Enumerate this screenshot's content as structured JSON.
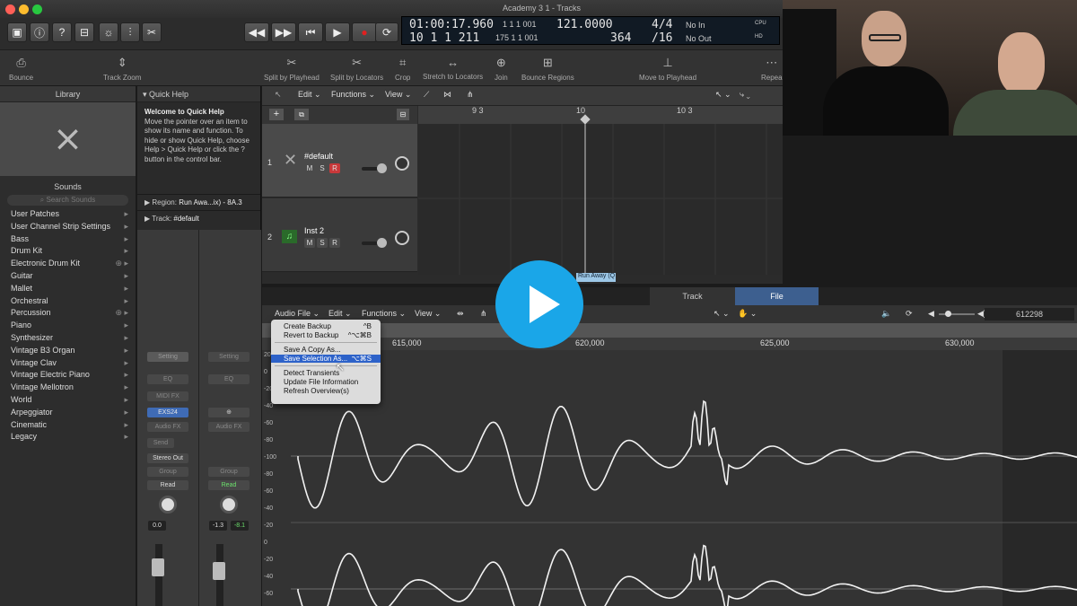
{
  "window": {
    "title": "Academy 3 1 - Tracks"
  },
  "lcd": {
    "smpte": "01:00:17.960",
    "position": "10  1  1  211",
    "sub_top": "1  1  1  001",
    "sub_bottom": "175  1  1  001",
    "sub2_top": "1  1  1  001",
    "sub2_bottom": "1  1  1  001",
    "tempo": "121.0000",
    "tempo2": "364",
    "sig_top": "4/4",
    "sig_bottom": "/16",
    "in": "No In",
    "out": "No Out",
    "cpu": "CPU",
    "hd": "HD"
  },
  "toolbar": {
    "items": [
      "Bounce",
      "Track Zoom",
      "Split by Playhead",
      "Split by Locators",
      "Crop",
      "Stretch to Locators",
      "Join",
      "Bounce Regions",
      "Move to Playhead",
      "Repea"
    ]
  },
  "library": {
    "header": "Library",
    "sounds_label": "Sounds",
    "search_placeholder": "Search Sounds",
    "items": [
      "User Patches",
      "User Channel Strip Settings",
      "Bass",
      "Drum Kit",
      "Electronic Drum Kit",
      "Guitar",
      "Mallet",
      "Orchestral",
      "Percussion",
      "Piano",
      "Synthesizer",
      "Vintage B3 Organ",
      "Vintage Clav",
      "Vintage Electric Piano",
      "Vintage Mellotron",
      "World",
      "Arpeggiator",
      "Cinematic",
      "Legacy"
    ]
  },
  "quickhelp": {
    "header": "Quick Help",
    "title": "Welcome to Quick Help",
    "body": "Move the pointer over an item to show its name and function. To hide or show Quick Help, choose Help > Quick Help or click the ? button in the control bar.",
    "region_label": "Region:",
    "region_value": "Run Awa...ix) - 8A.3",
    "track_label": "Track:",
    "track_value": "#default"
  },
  "strips": {
    "setting": "Setting",
    "eq": "EQ",
    "midifx": "MIDI FX",
    "exs": "EXS24",
    "audiofx": "Audio FX",
    "send": "Send",
    "stereo": "Stereo Out",
    "group": "Group",
    "read": "Read",
    "vol1": "0.0",
    "vol2": "-1.3",
    "vol3": "-8.1"
  },
  "tracks": {
    "menus": [
      "Edit",
      "Functions",
      "View"
    ],
    "ruler": [
      "9 3",
      "10",
      "10 3"
    ],
    "rows": [
      {
        "num": "1",
        "name": "#default"
      },
      {
        "num": "2",
        "name": "Inst 2"
      }
    ],
    "m": "M",
    "s": "S",
    "r": "R",
    "region_tag": "Run Away (Q"
  },
  "editor": {
    "tabs": [
      "Track",
      "File"
    ],
    "menus": [
      "Audio File",
      "Edit",
      "Functions",
      "View"
    ],
    "counter": "612298",
    "ruler": [
      "615,000",
      "620,000",
      "625,000",
      "630,000"
    ],
    "yaxis": [
      "20",
      "0",
      "-20",
      "-40",
      "-60",
      "-80",
      "-100",
      "-80",
      "-60",
      "-40",
      "-20",
      "0",
      "-20",
      "-40",
      "-60"
    ]
  },
  "dropdown": {
    "items": [
      {
        "label": "Create Backup",
        "shortcut": "^B"
      },
      {
        "label": "Revert to Backup",
        "shortcut": "^⌥⌘B"
      },
      {
        "label": "Save A Copy As...",
        "shortcut": ""
      },
      {
        "label": "Save Selection As...",
        "shortcut": "⌥⌘S"
      },
      {
        "label": "Detect Transients",
        "shortcut": ""
      },
      {
        "label": "Update File Information",
        "shortcut": ""
      },
      {
        "label": "Refresh Overview(s)",
        "shortcut": ""
      }
    ]
  },
  "colors": {
    "accent": "#2d62c9",
    "record": "#e02020",
    "play": "#1aa6e8"
  }
}
